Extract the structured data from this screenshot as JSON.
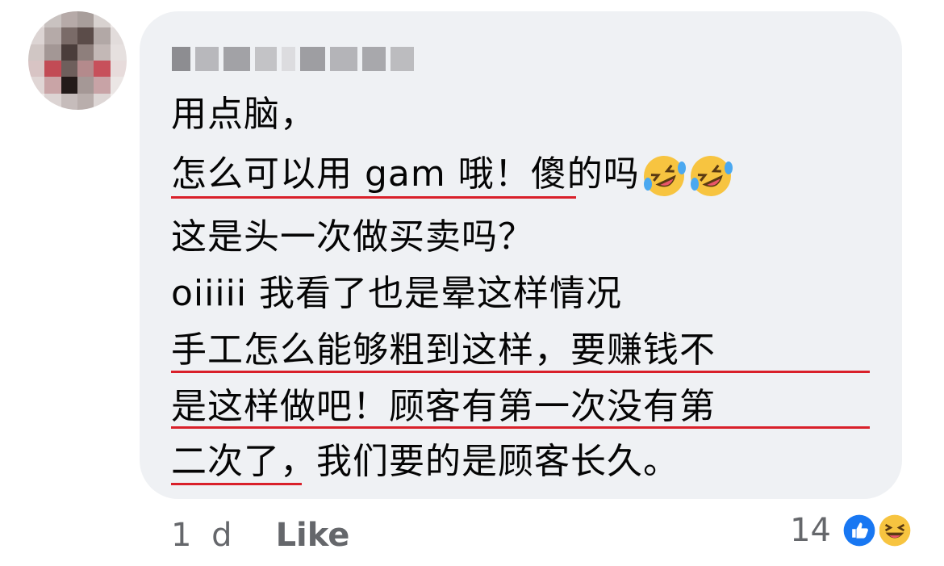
{
  "comment": {
    "author_name": "Karen Chen",
    "lines": [
      "用点脑，",
      "怎么可以用 gam 哦！傻的吗",
      "这是头一次做买卖吗？",
      "oiiiii 我看了也是晕这样情况",
      "手工怎么能够粗到这样，要赚钱不",
      "是这样做吧！顾客有第一次没有第",
      "二次了，我们要的是顾客长久。"
    ],
    "emoji_1": "rolling-on-floor-laughing",
    "emoji_2": "rolling-on-floor-laughing"
  },
  "footer": {
    "time": "1 d",
    "like_label": "Like",
    "reaction_count": "14",
    "reaction_icons": [
      "like-icon",
      "haha-icon"
    ]
  },
  "colors": {
    "bubble_bg": "#eff1f4",
    "underline": "#d9202a",
    "like_blue": "#1877f2",
    "haha_yellow": "#f7c440"
  }
}
